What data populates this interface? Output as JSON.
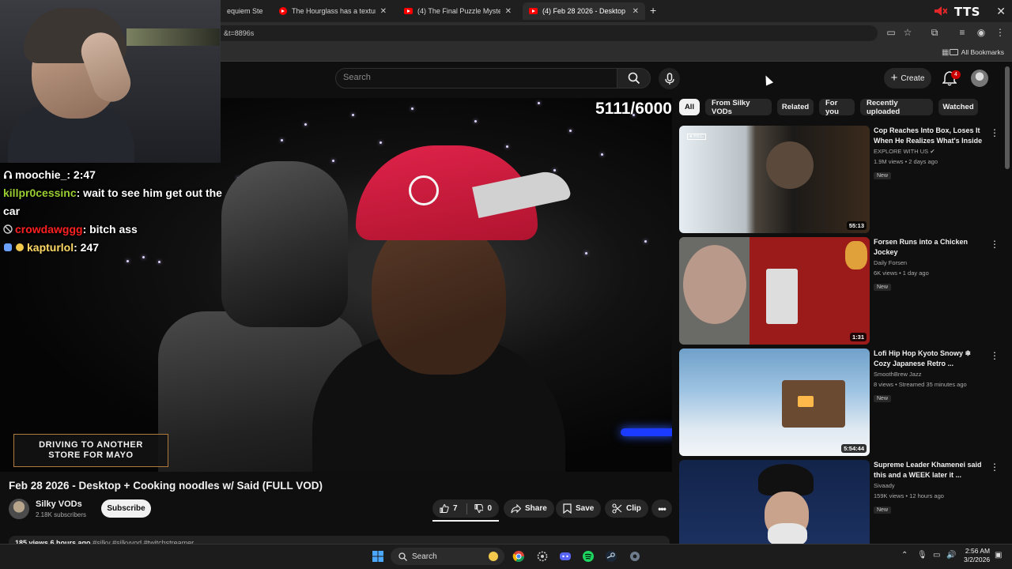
{
  "browser": {
    "tabs": [
      {
        "label": "equiem Ste"
      },
      {
        "label": "The Hourglass has a texture. :"
      },
      {
        "label": "(4) The Final Puzzle Mystery - F"
      },
      {
        "label": "(4) Feb 28 2026 - Desktop + Co"
      }
    ],
    "overlay_brand": "TTS",
    "url": "&t=8896s",
    "all_bookmarks": "All Bookmarks"
  },
  "header": {
    "search_placeholder": "Search",
    "create_label": "Create",
    "notification_count": "4"
  },
  "player": {
    "counter": "5111/6000",
    "overlay_line1": "DRIVING TO ANOTHER",
    "overlay_line2": "STORE FOR MAYO"
  },
  "chat": [
    {
      "user": "moochie_",
      "message": ": 2:47",
      "color": "#ffffff"
    },
    {
      "user": "killpr0cessinc",
      "message": ": wait to see him get out the car",
      "color": "#9acd32"
    },
    {
      "user": "crowdawggg",
      "message": ": bitch ass",
      "color": "#ff2020"
    },
    {
      "user": "kapturlol",
      "message": ": 247",
      "color": "#ffd966"
    }
  ],
  "video": {
    "title": "Feb 28 2026 - Desktop + Cooking noodles w/ Said (FULL VOD)",
    "channel": "Silky VODs",
    "subscribers": "2.18K subscribers",
    "subscribe_label": "Subscribe",
    "likes": "7",
    "dislikes": "0",
    "share_label": "Share",
    "save_label": "Save",
    "clip_label": "Clip",
    "desc_meta": "185 views  6 hours ago",
    "desc_tags": "#silky #silkyvod #twitchstreamer"
  },
  "chips": [
    "All",
    "From Silky VODs",
    "Related",
    "For you",
    "Recently uploaded",
    "Watched"
  ],
  "recommended": [
    {
      "title": "Cop Reaches Into Box, Loses It When He Realizes What's Inside",
      "channel": "EXPLORE WITH US ✔",
      "meta": "1.9M views • 2 days ago",
      "badge": "New",
      "duration": "55:13"
    },
    {
      "title": "Forsen Runs into a Chicken Jockey",
      "channel": "Daily Forsen",
      "meta": "6K views • 1 day ago",
      "badge": "New",
      "duration": "1:31"
    },
    {
      "title": "Lofi Hip Hop Kyoto Snowy ❄ Cozy Japanese Retro ...",
      "channel": "SmoothBrew Jazz",
      "meta": "8 views • Streamed 35 minutes ago",
      "badge": "New",
      "duration": "5:54:44"
    },
    {
      "title": "Supreme Leader Khamenei said this and a WEEK later it ...",
      "channel": "Sivaady",
      "meta": "159K views • 12 hours ago",
      "badge": "New",
      "duration": ""
    }
  ],
  "taskbar": {
    "search_label": "Search",
    "time": "2:56 AM",
    "date": "3/2/2026"
  },
  "colors": {
    "accent_red": "#ff0000",
    "background": "#0f0f0f",
    "chip_active": "#f1f1f1"
  }
}
